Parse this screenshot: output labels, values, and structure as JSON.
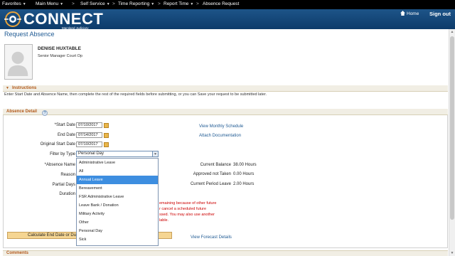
{
  "nav": {
    "favorites": "Favorites",
    "main_menu": "Main Menu",
    "self_service": "Self Service",
    "time_reporting": "Time Reporting",
    "report_time": "Report Time",
    "absence_request": "Absence Request",
    "separator": ">"
  },
  "brand": {
    "logo_text": "CONNECT",
    "logo_sub": "Maryland Judiciary",
    "home": "Home",
    "signout": "Sign out",
    "colors": {
      "nav_bg": "#000000",
      "band": "#1d5488",
      "accent": "#b35a1b",
      "link": "#1f5a93"
    }
  },
  "page": {
    "title": "Request Absence"
  },
  "employee": {
    "name": "DENISE HUXTABLE",
    "title": "Senior Manager Court Op"
  },
  "instructions": {
    "header": "Instructions",
    "text": "Enter Start Date and Absence Name, then complete the rest of the required fields before submitting, or you can Save your request to be submitted later."
  },
  "detail": {
    "header": "Absence Detail",
    "help": "?",
    "start_date_label": "*Start Date",
    "start_date": "07/10/2017",
    "end_date_label": "End Date",
    "end_date": "07/14/2017",
    "orig_start_label": "Original Start Date",
    "orig_start": "07/10/2017",
    "filter_label": "Filter by Type",
    "filter_value": "Personal Day",
    "absence_name_label": "*Absence Name",
    "reason_label": "Reason",
    "partial_days_label": "Partial Days",
    "duration_label": "Duration",
    "view_schedule": "View Monthly Schedule",
    "attach_doc": "Attach Documentation",
    "current_balance_label": "Current Balance",
    "current_balance": "38.00 Hours",
    "approved_not_taken_label": "Approved not Taken",
    "approved_not_taken": "0.00 Hours",
    "current_period_leave_label": "Current Period Leave",
    "current_period_leave": "2.00 Hours",
    "warning_lines": [
      "emaining because of other future",
      "r cancel a scheduled future",
      "ssed. You may also use another",
      "lable."
    ],
    "calc_button": "Calculate End Date or Du",
    "forecast": "View Forecast Details"
  },
  "dropdown": {
    "selected_index": 2,
    "options": [
      "Administrative Leave",
      "All",
      "Annual Leave",
      "Bereavement",
      "FSR Administrative Leave",
      "Leave Bank / Donation",
      "Military Activity",
      "Other",
      "Personal Day",
      "Sick"
    ]
  },
  "comments": {
    "header": "Comments"
  }
}
